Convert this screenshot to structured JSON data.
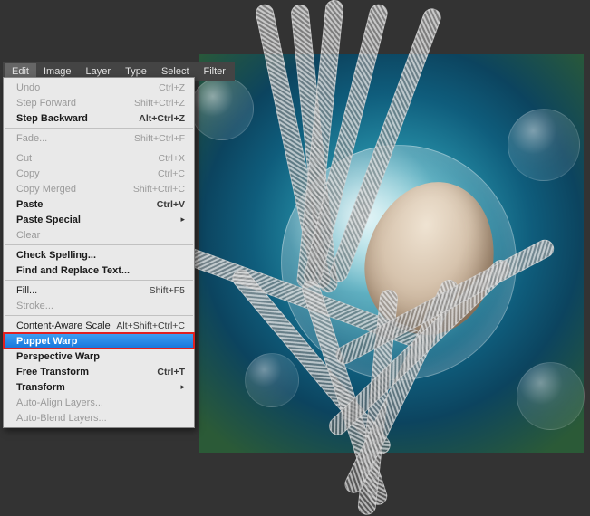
{
  "menubar": [
    "Edit",
    "Image",
    "Layer",
    "Type",
    "Select",
    "Filter"
  ],
  "menu": {
    "groups": [
      [
        {
          "label": "Undo",
          "shortcut": "Ctrl+Z",
          "disabled": true
        },
        {
          "label": "Step Forward",
          "shortcut": "Shift+Ctrl+Z",
          "disabled": true
        },
        {
          "label": "Step Backward",
          "shortcut": "Alt+Ctrl+Z",
          "bold": true
        }
      ],
      [
        {
          "label": "Fade...",
          "shortcut": "Shift+Ctrl+F",
          "disabled": true
        }
      ],
      [
        {
          "label": "Cut",
          "shortcut": "Ctrl+X",
          "disabled": true
        },
        {
          "label": "Copy",
          "shortcut": "Ctrl+C",
          "disabled": true
        },
        {
          "label": "Copy Merged",
          "shortcut": "Shift+Ctrl+C",
          "disabled": true
        },
        {
          "label": "Paste",
          "shortcut": "Ctrl+V",
          "bold": true
        },
        {
          "label": "Paste Special",
          "submenu": true,
          "bold": true
        },
        {
          "label": "Clear",
          "disabled": true
        }
      ],
      [
        {
          "label": "Check Spelling...",
          "bold": true
        },
        {
          "label": "Find and Replace Text...",
          "bold": true
        }
      ],
      [
        {
          "label": "Fill...",
          "shortcut": "Shift+F5"
        },
        {
          "label": "Stroke...",
          "disabled": true
        }
      ],
      [
        {
          "label": "Content-Aware Scale",
          "shortcut": "Alt+Shift+Ctrl+C"
        },
        {
          "label": "Puppet Warp",
          "selected": true,
          "bold": true
        },
        {
          "label": "Perspective Warp",
          "bold": true
        },
        {
          "label": "Free Transform",
          "shortcut": "Ctrl+T",
          "bold": true
        },
        {
          "label": "Transform",
          "submenu": true,
          "bold": true
        },
        {
          "label": "Auto-Align Layers...",
          "disabled": true
        },
        {
          "label": "Auto-Blend Layers...",
          "disabled": true
        }
      ]
    ]
  }
}
